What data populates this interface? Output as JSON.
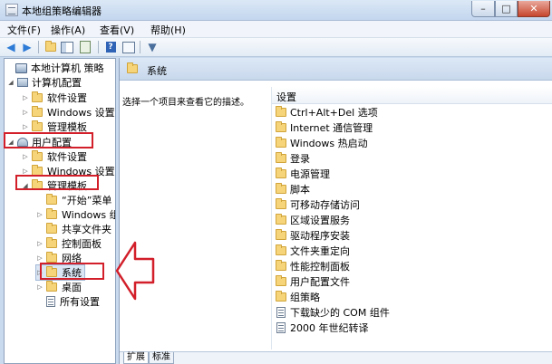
{
  "window": {
    "title": "本地组策略编辑器",
    "minimize": "–",
    "maximize": "□",
    "close": "✕"
  },
  "menu": [
    "文件(F)",
    "操作(A)",
    "查看(V)",
    "帮助(H)"
  ],
  "toolbar": {
    "icons": [
      "back-icon",
      "forward-icon",
      "up-folder-icon",
      "show-hide-tree-icon",
      "export-list-icon",
      "help-icon",
      "properties-icon",
      "filter-icon"
    ]
  },
  "tree": [
    {
      "label": "本地计算机 策略",
      "level": 0,
      "expanded": true,
      "icon": "computer"
    },
    {
      "label": "计算机配置",
      "level": 1,
      "expanded": true,
      "icon": "computer"
    },
    {
      "label": "软件设置",
      "level": 2,
      "expanded": false,
      "icon": "folder"
    },
    {
      "label": "Windows 设置",
      "level": 2,
      "expanded": false,
      "icon": "folder"
    },
    {
      "label": "管理模板",
      "level": 2,
      "expanded": false,
      "icon": "folder"
    },
    {
      "label": "用户配置",
      "level": 1,
      "expanded": true,
      "icon": "user",
      "highlighted": true
    },
    {
      "label": "软件设置",
      "level": 2,
      "expanded": false,
      "icon": "folder"
    },
    {
      "label": "Windows 设置",
      "level": 2,
      "expanded": false,
      "icon": "folder"
    },
    {
      "label": "管理模板",
      "level": 2,
      "expanded": true,
      "icon": "folder",
      "highlighted": true
    },
    {
      "label": "“开始”菜单",
      "level": 3,
      "expanded": null,
      "icon": "folder"
    },
    {
      "label": "Windows 组件",
      "level": 3,
      "expanded": false,
      "icon": "folder"
    },
    {
      "label": "共享文件夹",
      "level": 3,
      "expanded": null,
      "icon": "folder"
    },
    {
      "label": "控制面板",
      "level": 3,
      "expanded": false,
      "icon": "folder"
    },
    {
      "label": "网络",
      "level": 3,
      "expanded": false,
      "icon": "folder"
    },
    {
      "label": "系统",
      "level": 3,
      "expanded": false,
      "icon": "folder",
      "selected": true,
      "highlighted": true
    },
    {
      "label": "桌面",
      "level": 3,
      "expanded": false,
      "icon": "folder"
    },
    {
      "label": "所有设置",
      "level": 3,
      "expanded": null,
      "icon": "settings"
    }
  ],
  "right": {
    "header": "系统",
    "description": "选择一个项目来查看它的描述。",
    "column_header": "设置",
    "items": [
      {
        "label": "Ctrl+Alt+Del 选项",
        "icon": "folder"
      },
      {
        "label": "Internet 通信管理",
        "icon": "folder"
      },
      {
        "label": "Windows 热启动",
        "icon": "folder"
      },
      {
        "label": "登录",
        "icon": "folder"
      },
      {
        "label": "电源管理",
        "icon": "folder"
      },
      {
        "label": "脚本",
        "icon": "folder"
      },
      {
        "label": "可移动存储访问",
        "icon": "folder"
      },
      {
        "label": "区域设置服务",
        "icon": "folder"
      },
      {
        "label": "驱动程序安装",
        "icon": "folder"
      },
      {
        "label": "文件夹重定向",
        "icon": "folder"
      },
      {
        "label": "性能控制面板",
        "icon": "folder"
      },
      {
        "label": "用户配置文件",
        "icon": "folder"
      },
      {
        "label": "组策略",
        "icon": "folder"
      },
      {
        "label": "下载缺少的 COM 组件",
        "icon": "setting"
      },
      {
        "label": "2000 年世纪转译",
        "icon": "setting"
      }
    ],
    "tabs": [
      "扩展",
      "标准"
    ],
    "active_tab": "扩展"
  },
  "annotation_color": "#d21f2a"
}
